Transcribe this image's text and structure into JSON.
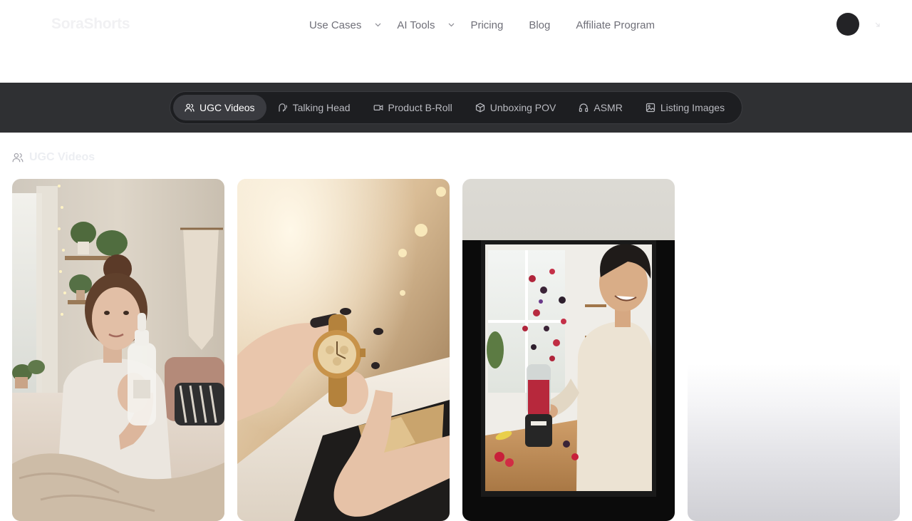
{
  "header": {
    "logo": "SoraShorts",
    "nav": [
      {
        "label": "Use Cases",
        "has_dropdown": true
      },
      {
        "label": "AI Tools",
        "has_dropdown": true
      },
      {
        "label": "Pricing",
        "has_dropdown": false
      },
      {
        "label": "Blog",
        "has_dropdown": false
      },
      {
        "label": "Affiliate Program",
        "has_dropdown": false
      }
    ]
  },
  "tabs": [
    {
      "label": "UGC Videos",
      "icon": "users-icon",
      "active": true
    },
    {
      "label": "Talking Head",
      "icon": "talking-head-icon",
      "active": false
    },
    {
      "label": "Product B-Roll",
      "icon": "video-camera-icon",
      "active": false
    },
    {
      "label": "Unboxing POV",
      "icon": "box-icon",
      "active": false
    },
    {
      "label": "ASMR",
      "icon": "headphones-icon",
      "active": false
    },
    {
      "label": "Listing Images",
      "icon": "image-icon",
      "active": false
    }
  ],
  "section": {
    "title": "UGC Videos",
    "icon": "users-icon"
  },
  "cards": [
    {
      "subject": "woman-holding-serum-bottle"
    },
    {
      "subject": "hands-holding-gold-watch-over-gift-box"
    },
    {
      "subject": "framed-man-making-smoothie"
    },
    {
      "subject": "loading-placeholder"
    }
  ],
  "colors": {
    "band": "#2f3033",
    "tabbar": "#1d1e21",
    "active_tab": "#3a3b40",
    "nav_text": "#6f6f78"
  }
}
